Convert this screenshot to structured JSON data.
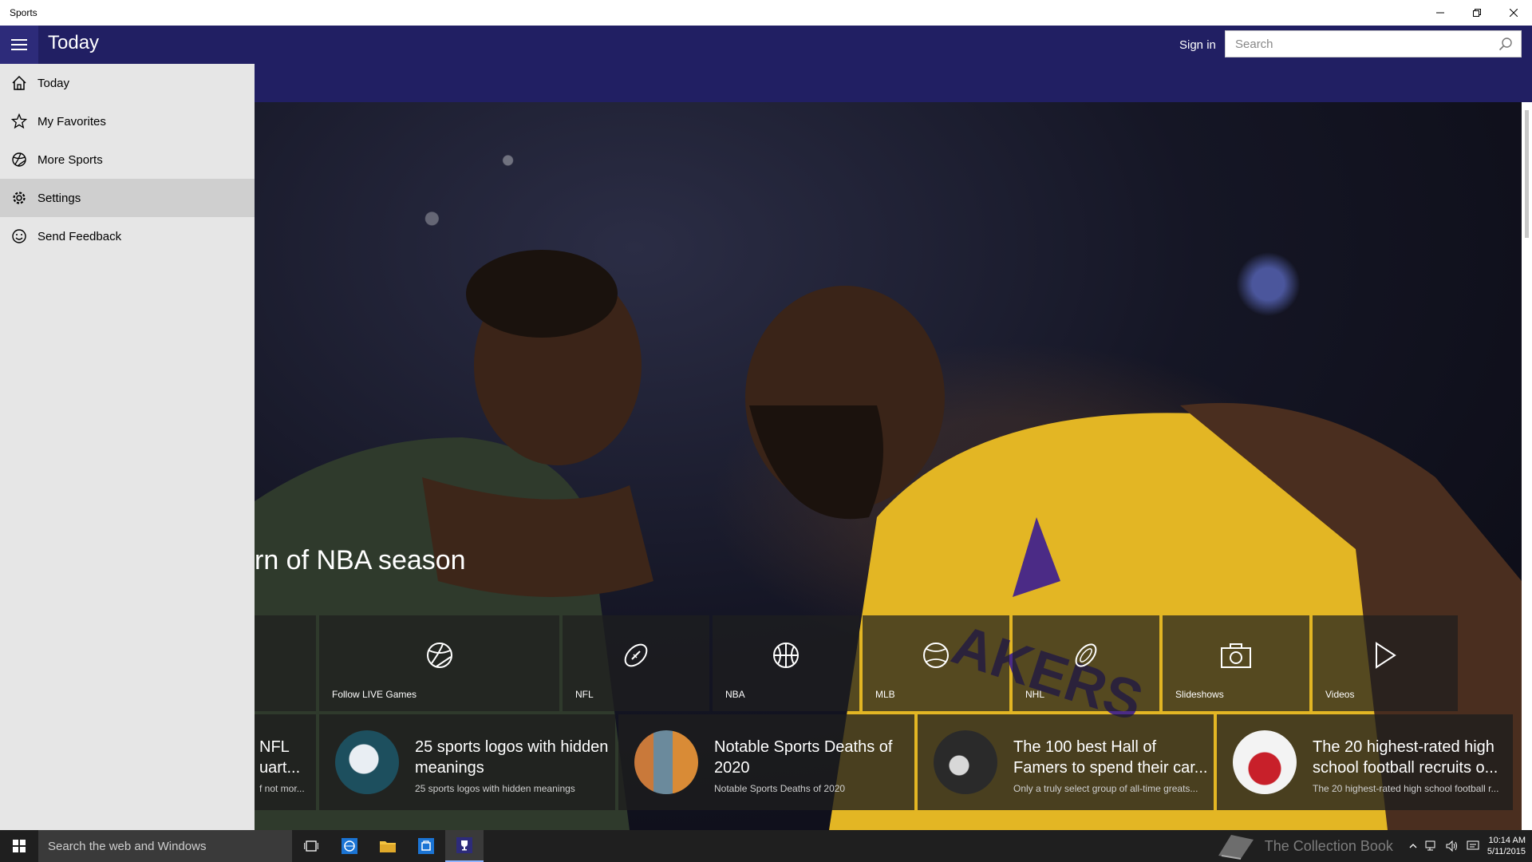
{
  "window": {
    "title": "Sports"
  },
  "header": {
    "page_title": "Today",
    "signin_label": "Sign in",
    "search_placeholder": "Search",
    "colors": {
      "header_bg": "#211f63",
      "nav_bg": "#e6e6e6",
      "nav_active": "#cfcfcf"
    }
  },
  "nav": {
    "items": [
      {
        "label": "Today",
        "icon": "home-icon"
      },
      {
        "label": "My Favorites",
        "icon": "star-icon"
      },
      {
        "label": "More Sports",
        "icon": "globe-ball-icon"
      },
      {
        "label": "Settings",
        "icon": "gear-icon",
        "active": true
      },
      {
        "label": "Send Feedback",
        "icon": "smiley-icon"
      }
    ]
  },
  "hero": {
    "headline": "rn of NBA season"
  },
  "tiles": [
    {
      "label": "Follow LIVE Games",
      "icon": "sports-ball-icon"
    },
    {
      "label": "NFL",
      "icon": "football-icon"
    },
    {
      "label": "NBA",
      "icon": "basketball-icon"
    },
    {
      "label": "MLB",
      "icon": "baseball-icon"
    },
    {
      "label": "NHL",
      "icon": "puck-icon"
    },
    {
      "label": "Slideshows",
      "icon": "camera-icon"
    },
    {
      "label": "Videos",
      "icon": "play-icon"
    }
  ],
  "news": [
    {
      "title": "NFL uart...",
      "subtitle": "f not mor..."
    },
    {
      "title": "25 sports logos with hidden meanings",
      "subtitle": "25 sports logos with hidden meanings"
    },
    {
      "title": "Notable Sports Deaths of 2020",
      "subtitle": "Notable Sports Deaths of 2020"
    },
    {
      "title": "The 100 best Hall of Famers to spend their car...",
      "subtitle": "Only a truly select group of all-time greats..."
    },
    {
      "title": "The 20 highest-rated high school football recruits o...",
      "subtitle": "The 20 highest-rated high school football r..."
    }
  ],
  "taskbar": {
    "search_text": "Search the web and Windows",
    "watermark": "The Collection Book",
    "time": "10:14 AM",
    "date": "5/11/2015"
  }
}
